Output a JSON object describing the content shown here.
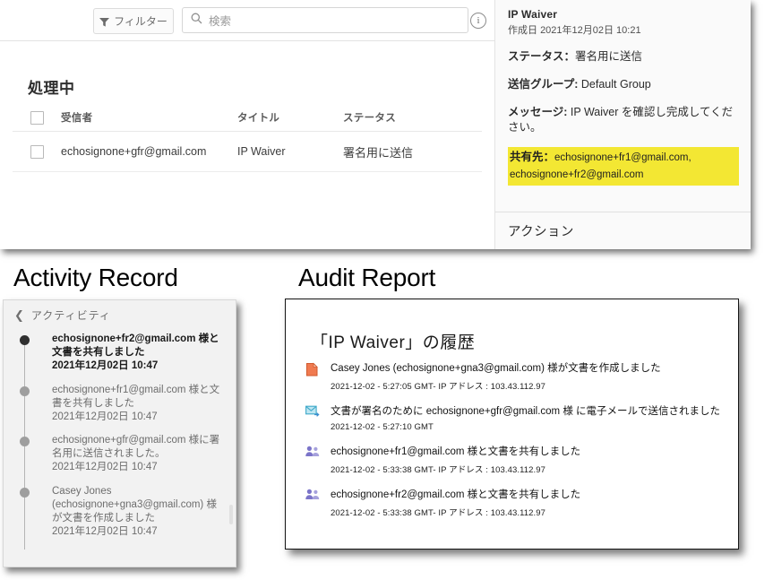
{
  "toolbar": {
    "filter_label": "フィルター",
    "filter_icon": "funnel-icon",
    "search_placeholder": "検索",
    "search_value": "",
    "search_icon": "search-icon",
    "info_icon": "info-icon",
    "info_glyph": "i"
  },
  "list": {
    "section_title": "処理中",
    "columns": [
      "受信者",
      "タイトル",
      "ステータス"
    ],
    "rows": [
      {
        "recipient": "echosignone+gfr@gmail.com",
        "title": "IP Waiver",
        "status": "署名用に送信",
        "checked": false
      }
    ]
  },
  "detail": {
    "title": "IP Waiver",
    "created_label": "作成日",
    "created_value": "2021年12月02日  10:21",
    "status_label": "ステータス",
    "status_value": "署名用に送信",
    "group_label": "送信グループ",
    "group_value": "Default Group",
    "message_label": "メッセージ",
    "message_value": "IP Waiver を確認し完成してください。",
    "shared_label": "共有先",
    "shared_value": "echosignone+fr1@gmail.com, echosignone+fr2@gmail.com",
    "highlight_color": "#f3e733",
    "actions_label": "アクション"
  },
  "captions": {
    "activity": "Activity Record",
    "audit": "Audit Report"
  },
  "activity": {
    "back_label": "アクティビティ",
    "back_icon": "chevron-left-icon",
    "items": [
      {
        "text": "echosignone+fr2@gmail.com 様と文書を共有しました",
        "date": "2021年12月02日  10:47",
        "current": true
      },
      {
        "text": "echosignone+fr1@gmail.com 様と文書を共有しました",
        "date": "2021年12月02日  10:47",
        "current": false
      },
      {
        "text": "echosignone+gfr@gmail.com 様に署名用に送信されました。",
        "date": "2021年12月02日  10:47",
        "current": false
      },
      {
        "text": "Casey Jones (echosignone+gna3@gmail.com) 様が文書を作成しました",
        "date": "2021年12月02日  10:47",
        "current": false
      }
    ]
  },
  "audit": {
    "title": "「IP Waiver」の履歴",
    "events": [
      {
        "icon": "document-created-icon",
        "icon_color": "#e8643c",
        "main": "Casey Jones (echosignone+gna3@gmail.com) 様が文書を作成しました",
        "sub": "2021-12-02 - 5:27:05 GMT- IP アドレス : 103.43.112.97"
      },
      {
        "icon": "email-sent-icon",
        "icon_color": "#4ab8d8",
        "main": "文書が署名のために echosignone+gfr@gmail.com 様 に電子メールで送信されました",
        "sub": "2021-12-02 - 5:27:10 GMT"
      },
      {
        "icon": "shared-users-icon",
        "icon_color": "#7b74c9",
        "main": "echosignone+fr1@gmail.com 様と文書を共有しました",
        "sub": "2021-12-02 - 5:33:38 GMT- IP アドレス : 103.43.112.97"
      },
      {
        "icon": "shared-users-icon",
        "icon_color": "#7b74c9",
        "main": "echosignone+fr2@gmail.com 様と文書を共有しました",
        "sub": "2021-12-02 - 5:33:38 GMT- IP アドレス : 103.43.112.97"
      }
    ]
  }
}
